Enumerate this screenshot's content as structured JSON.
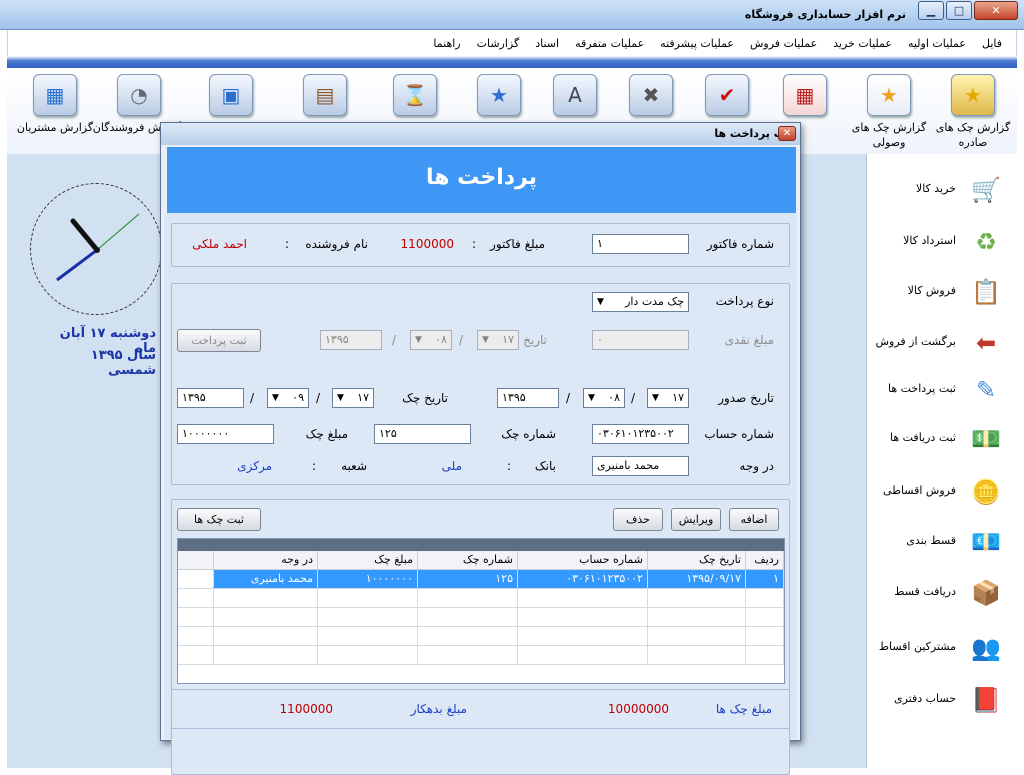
{
  "window": {
    "title": "نرم افزار حسابداری  فروشگاه"
  },
  "menu": [
    "فایل",
    "عملیات اولیه",
    "عملیات خرید",
    "عملیات فروش",
    "عملیات پیشرفته",
    "عملیات متفرقه",
    "اسناد",
    "گزارشات",
    "راهنما"
  ],
  "toolbar": [
    {
      "label": "گزارش چک های",
      "label2": "صادره",
      "icon": "folder-star-icon"
    },
    {
      "label": "گزارش چک های",
      "label2": "وصولی",
      "icon": "star-icon"
    },
    {
      "label": "",
      "label2": "",
      "icon": "calendar-icon"
    },
    {
      "label": "",
      "label2": "",
      "icon": "checkmark-folder-icon"
    },
    {
      "label": "",
      "label2": "",
      "icon": "x-folder-icon"
    },
    {
      "label": "",
      "label2": "",
      "icon": "a-folder-icon"
    },
    {
      "label": "",
      "label2": "",
      "icon": "star-folder-icon"
    },
    {
      "label": "",
      "label2": "",
      "icon": "hourglass-folder-icon"
    },
    {
      "label": "",
      "label2": "",
      "icon": "image-folder-icon"
    },
    {
      "label": "",
      "label2": "",
      "icon": "window-folder-icon"
    },
    {
      "label": "گزارش فروشندگان",
      "label2": "",
      "icon": "vendors-folder-icon"
    },
    {
      "label": "گزارش مشتریان",
      "label2": "",
      "icon": "customers-folder-icon"
    }
  ],
  "sidebar": [
    {
      "label": "خرید کالا",
      "icon": "shopping-cart-icon",
      "color": "#2e8b57"
    },
    {
      "label": "استرداد کالا",
      "icon": "recycle-box-icon",
      "color": "#6ab04c"
    },
    {
      "label": "فروش کالا",
      "icon": "notepad-icon",
      "color": "#3aa0d8"
    },
    {
      "label": "برگشت از فروش",
      "icon": "return-arrow-icon",
      "color": "#c0392b"
    },
    {
      "label": "ثبت پرداخت ها",
      "icon": "pen-paper-icon",
      "color": "#4a90d9"
    },
    {
      "label": "ثبت دریافت ها",
      "icon": "money-stack-icon",
      "color": "#3c9a3c"
    },
    {
      "label": "فروش اقساطی",
      "icon": "coins-icon",
      "color": "#d4a017"
    },
    {
      "label": "قسط بندی",
      "icon": "banknotes-icon",
      "color": "#4f9d4f"
    },
    {
      "label": "دریافت قسط",
      "icon": "package-down-icon",
      "color": "#c9a060"
    },
    {
      "label": "مشترکین اقساط",
      "icon": "users-icon",
      "color": "#3b5fc0"
    },
    {
      "label": "حساب دفتری",
      "icon": "ledger-book-icon",
      "color": "#9b2222"
    }
  ],
  "clock": {
    "date_line1": "دوشنبه  ۱۷ آبان ماه",
    "date_line2": "سال ۱۳۹۵ شمسی"
  },
  "dialog": {
    "title": "ثبت پرداخت ها",
    "heading": "پرداخت ها",
    "invoice_no_label": "شماره فاکتور",
    "invoice_no": "۱",
    "invoice_amount_label": "مبلغ فاکتور",
    "invoice_amount": "1100000",
    "seller_label": "نام فروشنده",
    "seller": "احمد ملکی",
    "colon": ":",
    "payment_type_label": "نوع پرداخت",
    "payment_type": "چک مدت دار",
    "cash_amount_label": "مبلغ نقدی",
    "cash_amount": "۰",
    "cash_date_label": "تاریخ",
    "cash_day": "۱۷",
    "cash_month": "۰۸",
    "cash_year": "۱۳۹۵",
    "slash": "/",
    "register_payment": "ثبت پرداخت",
    "issue_date_label": "تاریخ صدور",
    "issue_day": "۱۷",
    "issue_month": "۰۸",
    "issue_year": "۱۳۹۵",
    "check_date_label": "تاریخ چک",
    "check_day": "۱۷",
    "check_month": "۰۹",
    "check_year": "۱۳۹۵",
    "account_no_label": "شماره حساب",
    "account_no": "۰۳۰۶۱۰۱۲۳۵۰۰۲",
    "check_no_label": "شماره چک",
    "check_no": "۱۲۵",
    "check_amount_label": "مبلغ چک",
    "check_amount": "۱۰۰۰۰۰۰۰",
    "payee_label": "در وجه",
    "payee": "محمد بامنیری",
    "bank_label": "بانک",
    "bank": "ملی",
    "branch_label": "شعبه",
    "branch": "مرکزی",
    "add_btn": "اضافه",
    "edit_btn": "ویرایش",
    "delete_btn": "حذف",
    "register_checks_btn": "ثبت چک ها",
    "table": {
      "headers": [
        "ردیف",
        "تاریخ چک",
        "شماره حساب",
        "شماره چک",
        "مبلغ چک",
        "در وجه"
      ],
      "rows": [
        [
          "۱",
          "۱۳۹۵/۰۹/۱۷",
          "۰۳۰۶۱۰۱۲۳۵۰۰۲",
          "۱۲۵",
          "۱۰۰۰۰۰۰۰",
          "محمد بامنیری"
        ]
      ]
    },
    "total_checks_label": "مبلغ چک ها",
    "total_checks": "10000000",
    "debt_label": "مبلغ بدهکار",
    "debt": "1100000"
  }
}
